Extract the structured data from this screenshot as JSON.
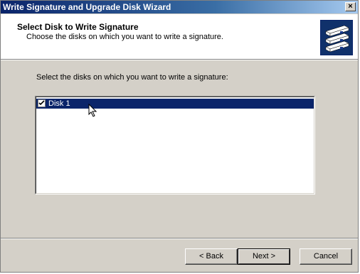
{
  "window": {
    "title": "Write Signature and Upgrade Disk Wizard",
    "close_label": "×"
  },
  "header": {
    "title": "Select Disk to Write Signature",
    "subtitle": "Choose the disks on which you want to write a signature.",
    "icon": "disk-stack-icon"
  },
  "content": {
    "prompt": "Select the disks on which you want to write a signature:",
    "disks": [
      {
        "label": "Disk 1",
        "checked": true,
        "selected": true
      }
    ]
  },
  "buttons": {
    "back": "< Back",
    "next": "Next >",
    "cancel": "Cancel"
  },
  "colors": {
    "selection": "#0a246a",
    "face": "#d4d0c8"
  }
}
